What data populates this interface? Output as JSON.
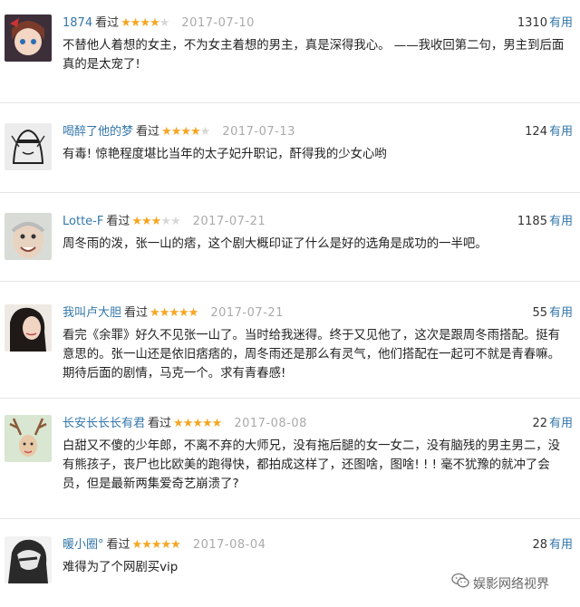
{
  "reviews": [
    {
      "username": "1874",
      "watched": "看过",
      "rating": 4,
      "date": "2017-07-10",
      "votes": "1310",
      "useful_label": "有用",
      "comment": "不替他人着想的女主，不为女主着想的男主，真是深得我心。 ——我收回第二句，男主到后面真的是太宠了!"
    },
    {
      "username": "喝醉了他的梦",
      "watched": "看过",
      "rating": 4,
      "date": "2017-07-13",
      "votes": "124",
      "useful_label": "有用",
      "comment": "有毒! 惊艳程度堪比当年的太子妃升职记，酐得我的少女心哟"
    },
    {
      "username": "Lotte-F",
      "watched": "看过",
      "rating": 3,
      "date": "2017-07-21",
      "votes": "1185",
      "useful_label": "有用",
      "comment": "周冬雨的泼，张一山的痞，这个剧大概印证了什么是好的选角是成功的一半吧。"
    },
    {
      "username": "我叫卢大胆",
      "watched": "看过",
      "rating": 5,
      "date": "2017-07-21",
      "votes": "55",
      "useful_label": "有用",
      "comment": "看完《余罪》好久不见张一山了。当时给我迷得。终于又见他了，这次是跟周冬雨搭配。挺有意思的。张一山还是依旧痞痞的，周冬雨还是那么有灵气，他们搭配在一起可不就是青春嘛。期待后面的剧情，马克一个。求有青春感!"
    },
    {
      "username": "长安长长长有君",
      "watched": "看过",
      "rating": 5,
      "date": "2017-08-08",
      "votes": "22",
      "useful_label": "有用",
      "comment": "白甜又不傻的少年郎，不离不弃的大师兄，没有拖后腿的女一女二，没有脑残的男主男二，没有熊孩子，丧尸也比欧美的跑得快，都拍成这样了，还图啥，图啥! ! ! 毫不犹豫的就冲了会员，但是最新两集爱奇艺崩溃了?"
    },
    {
      "username": "暖小圈°",
      "watched": "看过",
      "rating": 5,
      "date": "2017-08-04",
      "votes": "28",
      "useful_label": "有用",
      "comment": "难得为了个网剧买vip"
    }
  ],
  "watermark": {
    "text": "娱影网络视界",
    "icon": "wechat-icon"
  },
  "colors": {
    "link": "#3377aa",
    "star": "#f5a623",
    "star_off": "#d8d8d8",
    "date": "#aaaaaa"
  }
}
